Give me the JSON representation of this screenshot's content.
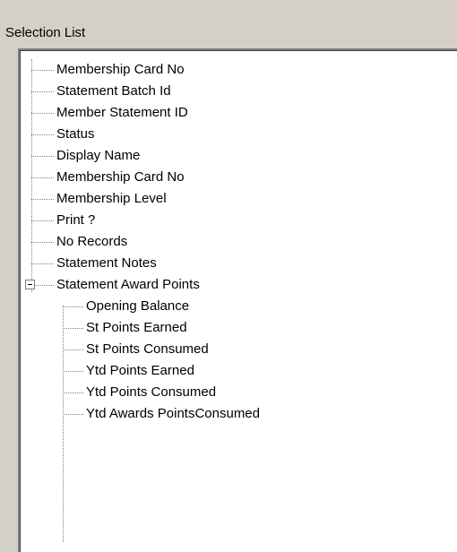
{
  "panel": {
    "title": "Selection List"
  },
  "tree": {
    "items": [
      "Membership Card No",
      "Statement Batch Id",
      "Member Statement ID",
      "Status",
      "Display Name",
      "Membership Card No",
      "Membership Level",
      "Print ?",
      "No Records",
      "Statement Notes"
    ],
    "group": {
      "label": "Statement Award Points",
      "expanded": true,
      "children": [
        "Opening Balance",
        "St Points Earned",
        "St Points Consumed",
        "Ytd Points Earned",
        "Ytd Points Consumed",
        "Ytd Awards PointsConsumed"
      ]
    }
  }
}
